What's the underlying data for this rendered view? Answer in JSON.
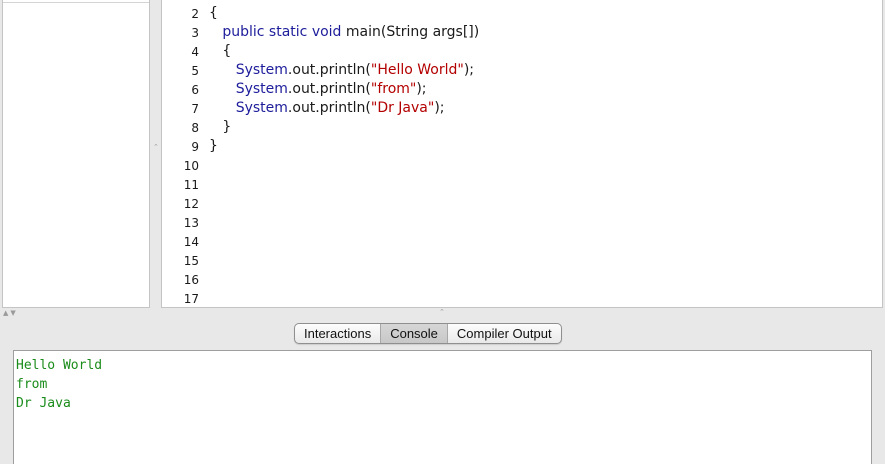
{
  "editor": {
    "line_numbers": [
      "2",
      "3",
      "4",
      "5",
      "6",
      "7",
      "8",
      "9",
      "10",
      "11",
      "12",
      "13",
      "14",
      "15",
      "16",
      "17"
    ],
    "code_lines": [
      [
        {
          "t": "{",
          "c": "plain"
        }
      ],
      [
        {
          "t": "   public static void ",
          "c": "kw"
        },
        {
          "t": "main(String args[])",
          "c": "plain"
        }
      ],
      [
        {
          "t": "   {",
          "c": "plain"
        }
      ],
      [
        {
          "t": "      System",
          "c": "ident"
        },
        {
          "t": ".out.println(",
          "c": "plain"
        },
        {
          "t": "\"Hello World\"",
          "c": "str"
        },
        {
          "t": ");",
          "c": "plain"
        }
      ],
      [
        {
          "t": "      System",
          "c": "ident"
        },
        {
          "t": ".out.println(",
          "c": "plain"
        },
        {
          "t": "\"from\"",
          "c": "str"
        },
        {
          "t": ");",
          "c": "plain"
        }
      ],
      [
        {
          "t": "      System",
          "c": "ident"
        },
        {
          "t": ".out.println(",
          "c": "plain"
        },
        {
          "t": "\"Dr Java\"",
          "c": "str"
        },
        {
          "t": ");",
          "c": "plain"
        }
      ],
      [
        {
          "t": "   }",
          "c": "plain"
        }
      ],
      [
        {
          "t": "}",
          "c": "plain"
        }
      ]
    ]
  },
  "tabs": [
    {
      "label": "Interactions",
      "selected": false
    },
    {
      "label": "Console",
      "selected": true
    },
    {
      "label": "Compiler Output",
      "selected": false
    }
  ],
  "console": {
    "lines": [
      "Hello World",
      "from",
      "Dr Java"
    ],
    "text_color": "#1a8c1a"
  },
  "colors": {
    "keyword": "#1d1d9b",
    "string": "#b30000",
    "console_output": "#1a8c1a"
  }
}
